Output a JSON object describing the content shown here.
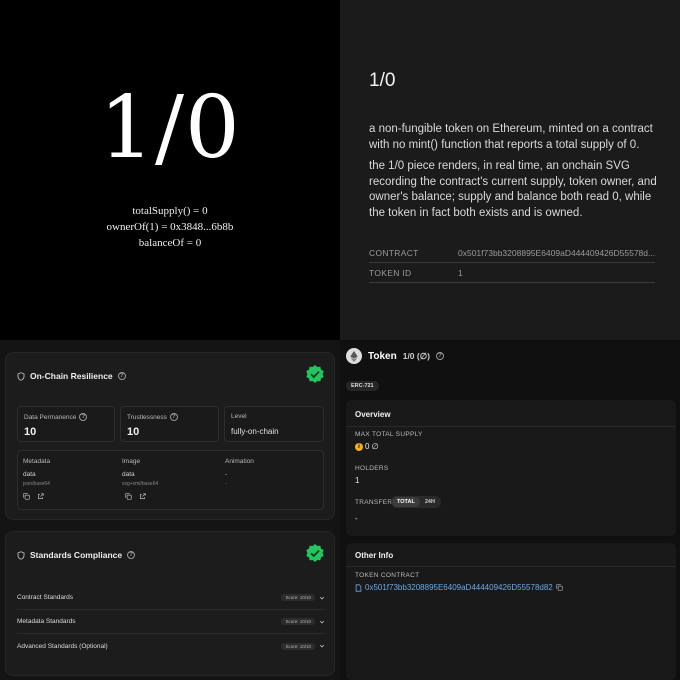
{
  "artwork": {
    "title": "1/0",
    "lines": [
      "totalSupply() = 0",
      "ownerOf(1) = 0x3848...6b8b",
      "balanceOf = 0"
    ]
  },
  "description": {
    "title": "1/0",
    "paragraph1": "a non-fungible token on Ethereum, minted on a contract with no mint() function that reports a total supply of 0.",
    "paragraph2": "the 1/0 piece renders, in real time, an onchain SVG recording the contract's current supply, token owner, and owner's balance; supply and balance both read 0, while the token in fact both exists and is owned.",
    "rows": [
      {
        "key": "CONTRACT",
        "value": "0x501f73bb3208895E6409aD444409426D55578d..."
      },
      {
        "key": "TOKEN ID",
        "value": "1"
      }
    ]
  },
  "resilience": {
    "title": "On-Chain Resilience",
    "metrics": [
      {
        "label": "Data Permanence",
        "value": "10"
      },
      {
        "label": "Trustlessness",
        "value": "10"
      },
      {
        "label": "Level",
        "value": "fully-on-chain"
      }
    ],
    "storage": [
      {
        "label": "Metadata",
        "type": "data",
        "encoding": "json/base64"
      },
      {
        "label": "Image",
        "type": "data",
        "encoding": "svg+xml/base64"
      },
      {
        "label": "Animation",
        "type": "-",
        "encoding": "-"
      }
    ]
  },
  "standards": {
    "title": "Standards Compliance",
    "rows": [
      {
        "label": "Contract Standards",
        "score": "Score: 10/10"
      },
      {
        "label": "Metadata Standards",
        "score": "Score: 10/10"
      },
      {
        "label": "Advanced Standards (Optional)",
        "score": "Score: 10/10"
      }
    ]
  },
  "token": {
    "name": "Token",
    "sub": "1/0 (∅)",
    "badge": "ERC-721",
    "overview": {
      "title": "Overview",
      "max_supply_label": "MAX TOTAL SUPPLY",
      "max_supply_value": "0 ∅",
      "coin_glyph": "i",
      "holders_label": "HOLDERS",
      "holders_value": "1",
      "transfers_label": "TRANSFERS",
      "transfers_tabs": [
        "TOTAL",
        "24H"
      ],
      "transfers_value": "-"
    },
    "other": {
      "title": "Other Info",
      "contract_label": "TOKEN CONTRACT",
      "contract_value": "0x501f73bb3208895E6409aD444409426D55578d82"
    }
  },
  "colors": {
    "accent_green": "#22c55e",
    "link_blue": "#6aa9e6",
    "coin_gold": "#f2b01e"
  }
}
